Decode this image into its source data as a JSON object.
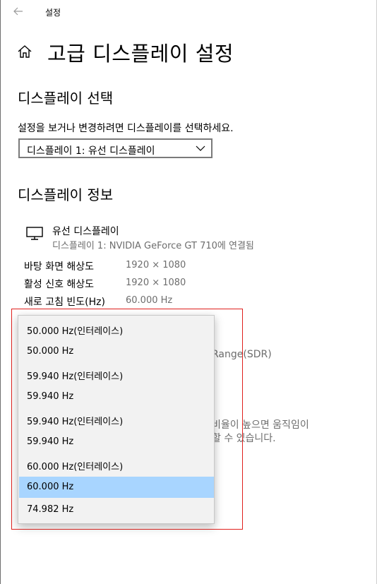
{
  "window": {
    "title": "설정"
  },
  "page": {
    "title": "고급 디스플레이 설정"
  },
  "select_section": {
    "heading": "디스플레이 선택",
    "description": "설정을 보거나 변경하려면 디스플레이를 선택하세요.",
    "combo_value": "디스플레이 1: 유선 디스플레이"
  },
  "info_section": {
    "heading": "디스플레이 정보",
    "display_name": "유선 디스플레이",
    "display_sub": "디스플레이 1: NVIDIA GeForce GT 710에 연결됨",
    "rows": [
      {
        "label": "바탕 화면 해상도",
        "value": "1920 × 1080"
      },
      {
        "label": "활성 신호 해상도",
        "value": "1920 × 1080"
      },
      {
        "label": "새로 고침 빈도(Hz)",
        "value": "60.000 Hz"
      }
    ]
  },
  "background_partial_text": {
    "range": "Range(SDR)",
    "line1": "비율이 높으면 움직임이",
    "line2": "할 수 있습니다."
  },
  "dropdown": {
    "selected_index": 7,
    "options": [
      "50.000 Hz(인터레이스)",
      "50.000 Hz",
      "59.940 Hz(인터레이스)",
      "59.940 Hz",
      "59.940 Hz(인터레이스)",
      "59.940 Hz",
      "60.000 Hz(인터레이스)",
      "60.000 Hz",
      "74.982 Hz"
    ]
  },
  "colors": {
    "highlight_border": "#e0201d",
    "selected_item": "#a8d5ff",
    "dropdown_bg": "#f2f2f2",
    "secondary_text": "#6d6d6d"
  },
  "icons": {
    "back": "back-arrow-icon",
    "home": "home-icon",
    "chevron": "chevron-down-icon",
    "monitor": "monitor-icon"
  }
}
